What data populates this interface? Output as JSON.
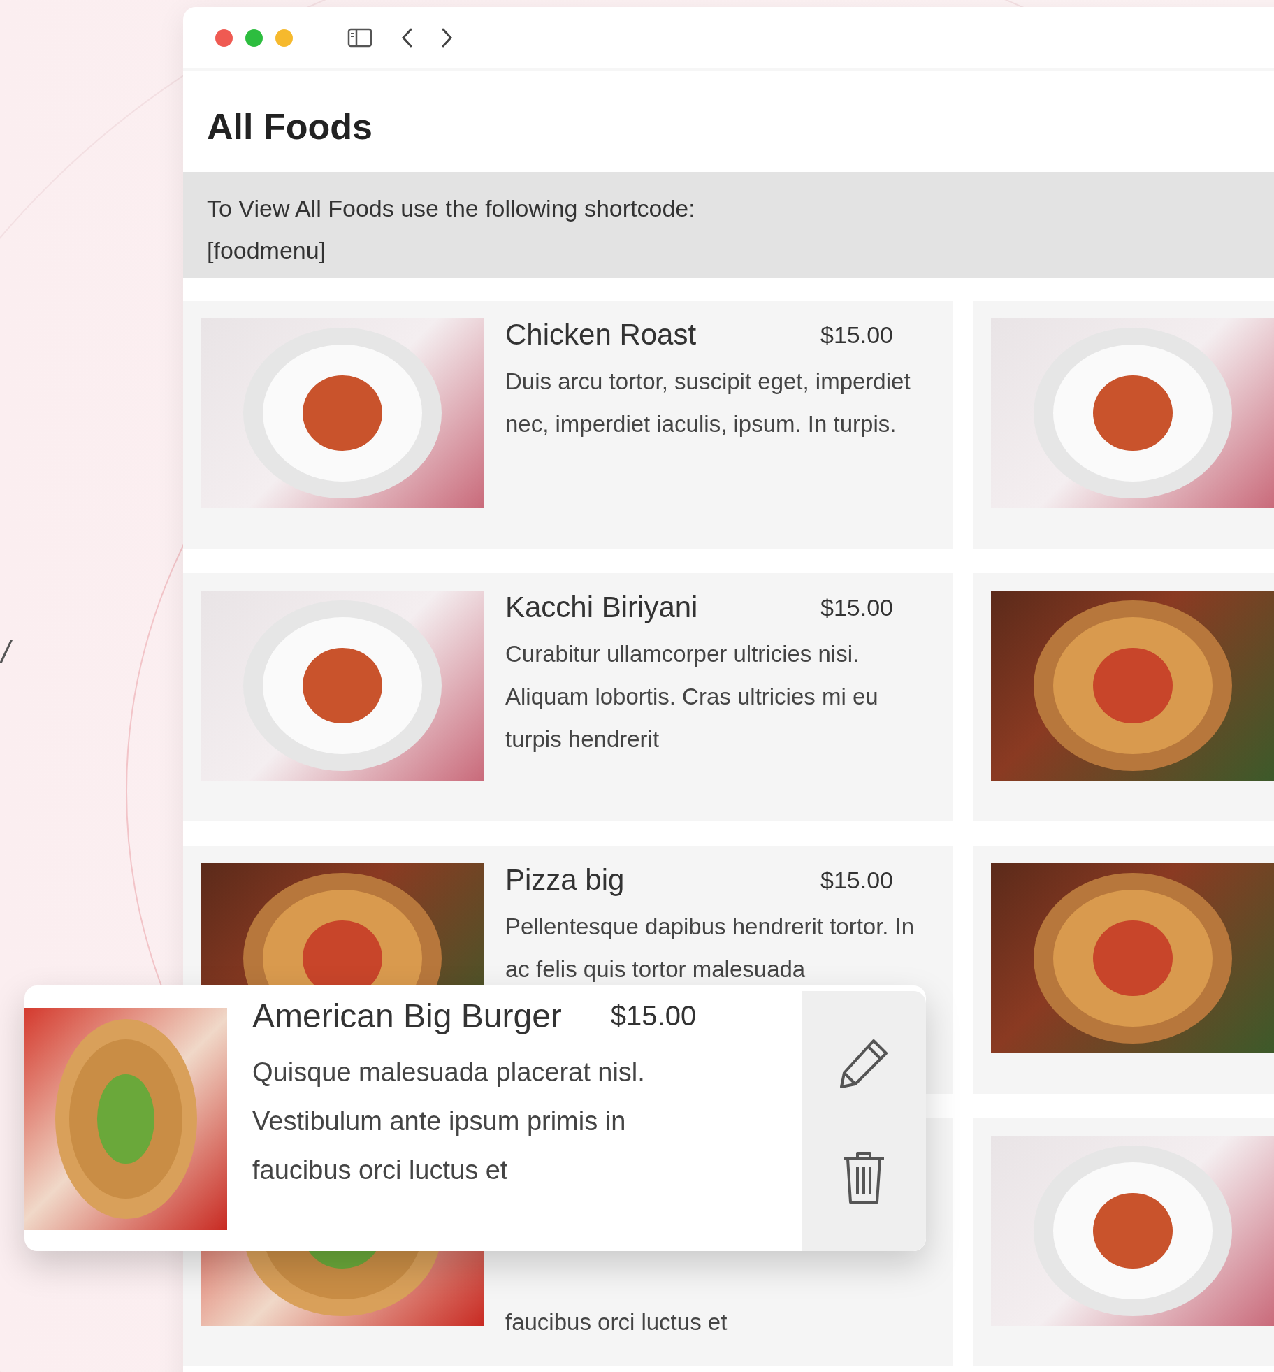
{
  "decor_text": "/",
  "page_title": "All Foods",
  "notice": {
    "text": "To View All Foods use the following shortcode:",
    "shortcode": "[foodmenu]"
  },
  "food_cards": [
    {
      "kind": "pasta",
      "title": "Chicken Roast",
      "price": "$15.00",
      "description": "Duis arcu tortor, suscipit eget, imperdiet nec, imperdiet iaculis, ipsum. In turpis."
    },
    {
      "kind": "pasta"
    },
    {
      "kind": "pasta",
      "title": "Kacchi Biriyani",
      "price": "$15.00",
      "description": "Curabitur ullamcorper ultricies nisi. Aliquam lobortis. Cras ultricies mi eu turpis hendrerit"
    },
    {
      "kind": "pizza"
    },
    {
      "kind": "pizza",
      "title": "Pizza big",
      "price": "$15.00",
      "description": "Pellentesque dapibus hendrerit tortor. In ac felis quis tortor malesuada"
    },
    {
      "kind": "pizza"
    },
    {
      "kind": "burger",
      "description": "faucibus orci luctus et"
    },
    {
      "kind": "pasta"
    }
  ],
  "floating_card": {
    "kind": "burger",
    "title": "American Big Burger",
    "price": "$15.00",
    "description": "Quisque malesuada placerat nisl. Vestibulum ante ipsum primis in faucibus orci luctus et"
  }
}
